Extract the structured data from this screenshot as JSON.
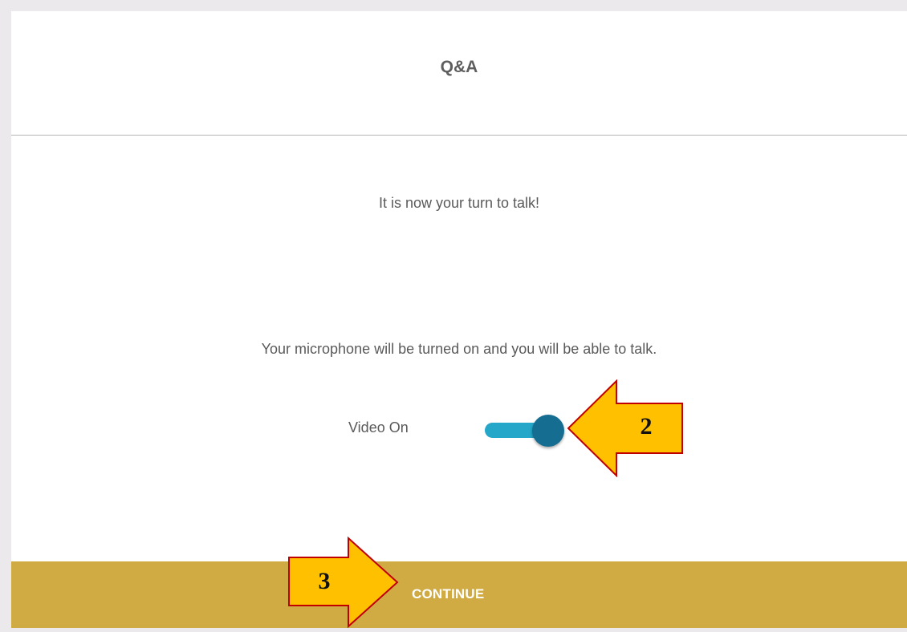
{
  "dialog": {
    "title": "Q&A",
    "message_primary": "It is now your turn to talk!",
    "message_secondary": "Your microphone will be turned on and you will be able to talk.",
    "video_toggle": {
      "label": "Video On",
      "state": "on"
    },
    "continue_label": "CONTINUE"
  },
  "annotations": {
    "callout_toggle_number": "2",
    "callout_continue_number": "3"
  },
  "colors": {
    "background": "#ece9ed",
    "footer": "#d0ab44",
    "toggle_track": "#25a7c9",
    "toggle_knob": "#156d91",
    "callout_fill": "#ffc000",
    "callout_stroke": "#c00000"
  }
}
